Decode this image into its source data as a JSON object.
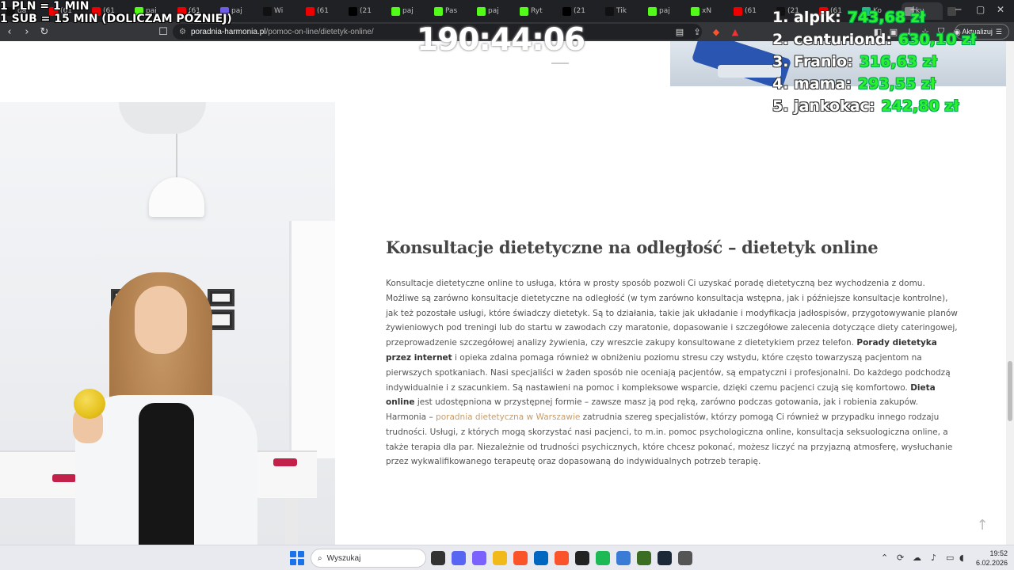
{
  "browser": {
    "tabs": [
      {
        "label": "da",
        "favicon": "tiktok",
        "color": "#111"
      },
      {
        "label": "(61",
        "favicon": "youtube",
        "color": "#e00"
      },
      {
        "label": "(61",
        "favicon": "youtube",
        "color": "#e00"
      },
      {
        "label": "paj",
        "favicon": "kick",
        "color": "#53fc18"
      },
      {
        "label": "(61",
        "favicon": "youtube",
        "color": "#e00"
      },
      {
        "label": "paj",
        "favicon": "app",
        "color": "#6c5ce7"
      },
      {
        "label": "Wi",
        "favicon": "tiktok",
        "color": "#111"
      },
      {
        "label": "(61",
        "favicon": "youtube",
        "color": "#e00"
      },
      {
        "label": "(21",
        "favicon": "x",
        "color": "#000"
      },
      {
        "label": "paj",
        "favicon": "kick",
        "color": "#53fc18"
      },
      {
        "label": "Pas",
        "favicon": "kick",
        "color": "#53fc18"
      },
      {
        "label": "paj",
        "favicon": "kick",
        "color": "#53fc18"
      },
      {
        "label": "Ryt",
        "favicon": "kick",
        "color": "#53fc18"
      },
      {
        "label": "(21",
        "favicon": "x",
        "color": "#000"
      },
      {
        "label": "Tik",
        "favicon": "tiktok",
        "color": "#111"
      },
      {
        "label": "paj",
        "favicon": "kick",
        "color": "#53fc18"
      },
      {
        "label": "xN",
        "favicon": "kick",
        "color": "#53fc18"
      },
      {
        "label": "(61",
        "favicon": "youtube",
        "color": "#e00"
      },
      {
        "label": "(21",
        "favicon": "tiktok",
        "color": "#111"
      },
      {
        "label": "(61",
        "favicon": "youtube",
        "color": "#e00"
      },
      {
        "label": "Ko",
        "favicon": "app",
        "color": "#2b8"
      },
      {
        "label": "ku",
        "favicon": "app",
        "color": "#888"
      },
      {
        "label": "",
        "favicon": "app",
        "color": "#444"
      }
    ],
    "url_host": "poradnia-harmonia.pl",
    "url_path": "/pomoc-on-line/dietetyk-online/",
    "update_label": "Aktualizuj",
    "notif_badge": "1"
  },
  "overlay": {
    "rate_line1": "1 PLN = 1 MIN",
    "rate_line2": "1 SUB = 15 MIN (DOLICZAM PÓŹNIEJ)",
    "timer": "190:44:06",
    "leaderboard": [
      {
        "name": "1. alpik:",
        "amount": "743,68 zł"
      },
      {
        "name": "2. centuriond:",
        "amount": "630,10 zł"
      },
      {
        "name": "3. Franio:",
        "amount": "316,63 zł"
      },
      {
        "name": "4. mama:",
        "amount": "293,55 zł"
      },
      {
        "name": "5. jankokac:",
        "amount": "242,80 zł"
      }
    ]
  },
  "article": {
    "title": "Konsultacje dietetyczne na odległość – dietetyk online",
    "p1_a": "Konsultacje dietetyczne online to usługa, która w prosty sposób pozwoli Ci uzyskać poradę dietetyczną bez wychodzenia z domu. Możliwe są zarówno konsultacje dietetyczne na odległość (w tym zarówno konsultacja wstępna, jak i późniejsze konsultacje kontrolne), jak też pozostałe usługi, które świadczy dietetyk. Są to działania, takie jak układanie i modyfikacja jadłospisów, przygotowywanie planów żywieniowych pod treningi lub do startu w zawodach czy maratonie, dopasowanie i szczegółowe zalecenia dotyczące diety cateringowej, przeprowadzenie szczegółowej analizy żywienia, czy wreszcie zakupy konsultowane z dietetykiem przez telefon. ",
    "p1_b": "Porady dietetyka przez internet",
    "p1_c": " i opieka zdalna pomaga również w obniżeniu poziomu stresu czy wstydu, które często towarzyszą pacjentom na pierwszych spotkaniach. Nasi specjaliści w żaden sposób nie oceniają pacjentów, są empatyczni i profesjonalni. Do każdego podchodzą indywidualnie i z szacunkiem. Są nastawieni na pomoc i kompleksowe wsparcie, dzięki czemu pacjenci czują się komfortowo. ",
    "p1_d": "Dieta online",
    "p1_e": " jest udostępniona w przystępnej formie – zawsze masz ją pod ręką, zarówno podczas gotowania, jak i robienia zakupów.",
    "p2_a": "Harmonia – ",
    "p2_link": "poradnia dietetyczna w Warszawie",
    "p2_b": " zatrudnia szereg specjalistów, którzy pomogą Ci również w przypadku innego rodzaju trudności. Usługi, z których mogą skorzystać nasi pacjenci, to m.in. pomoc psychologiczna online, konsultacja seksuologiczna online, a także terapia dla par. Niezależnie od trudności psychicznych, które chcesz pokonać, możesz liczyć na przyjazną atmosferę, wysłuchanie przez wykwalifikowanego terapeutę oraz dopasowaną do indywidualnych potrzeb terapię."
  },
  "taskbar": {
    "search_placeholder": "Wyszukaj",
    "time": "19:52",
    "date": "6.02.2026",
    "apps": [
      {
        "name": "task-view",
        "color": "#333"
      },
      {
        "name": "discord",
        "color": "#5865f2"
      },
      {
        "name": "copilot",
        "color": "#7b61ff"
      },
      {
        "name": "file-explorer",
        "color": "#f2b91a"
      },
      {
        "name": "brave",
        "color": "#fb542b"
      },
      {
        "name": "store",
        "color": "#0067c0"
      },
      {
        "name": "brave-active",
        "color": "#fb542b"
      },
      {
        "name": "obs",
        "color": "#222"
      },
      {
        "name": "spotify",
        "color": "#1db954"
      },
      {
        "name": "notepad",
        "color": "#3a7bd5"
      },
      {
        "name": "app-green",
        "color": "#3b6e22"
      },
      {
        "name": "steam",
        "color": "#1b2838"
      },
      {
        "name": "calculator",
        "color": "#555"
      }
    ]
  }
}
